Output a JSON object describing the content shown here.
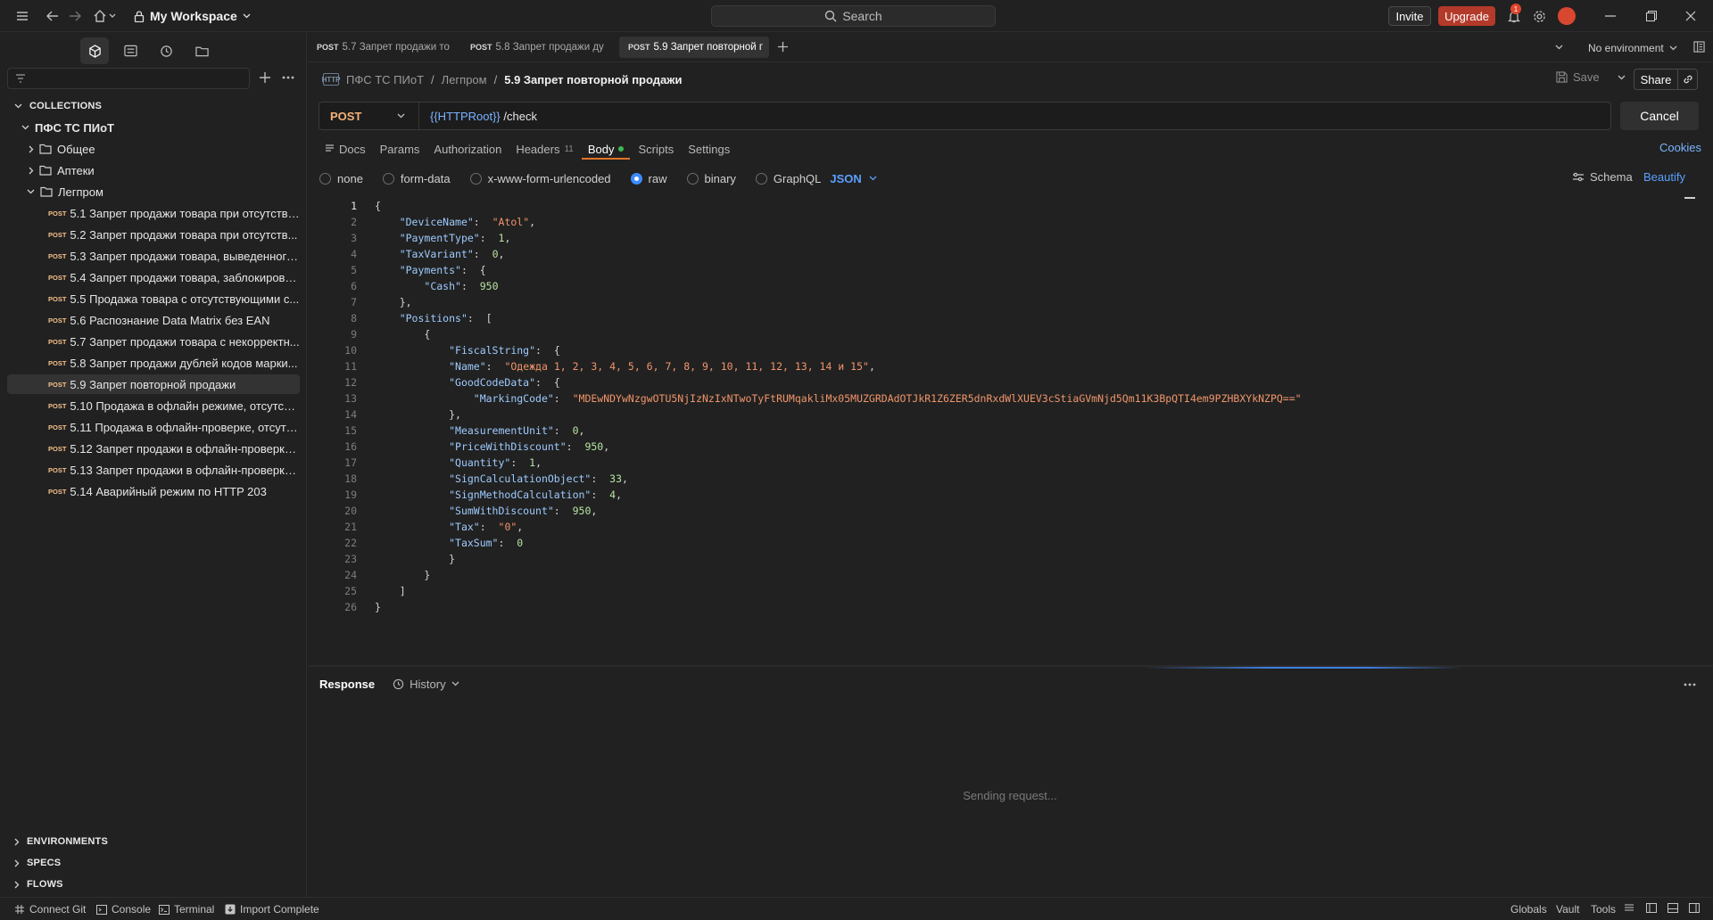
{
  "titlebar": {
    "workspace": "My Workspace",
    "search_placeholder": "Search",
    "invite": "Invite",
    "upgrade": "Upgrade",
    "notification_count": "1"
  },
  "sidebar": {
    "filter_placeholder": "",
    "collections_header": "COLLECTIONS",
    "collection_name": "ПФС ТС ПИоТ",
    "folders": [
      "Общее",
      "Аптеки",
      "Легпром"
    ],
    "method_badge": "POST",
    "requests": [
      "5.1 Запрет продажи товара при отсутстви...",
      "5.2 Запрет продажи товара при отсутств...",
      "5.3 Запрет продажи товара, выведенного...",
      "5.4 Запрет продажи товара, заблокирова...",
      "5.5 Продажа товара с отсутствующими с...",
      "5.6 Распознание Data Matrix без EAN",
      "5.7 Запрет продажи товара с некорректн...",
      "5.8 Запрет продажи дублей кодов марки...",
      "5.9 Запрет повторной продажи",
      "5.10 Продажа в офлайн режиме, отсутств...",
      "5.11 Продажа в офлайн-проверке, отсутст...",
      "5.12 Запрет продажи в офлайн-проверке,...",
      "5.13 Запрет продажи в офлайн-проверке ...",
      "5.14 Аварийный режим по HTTP 203"
    ],
    "environments_header": "ENVIRONMENTS",
    "specs_header": "SPECS",
    "flows_header": "FLOWS"
  },
  "tabs": [
    {
      "method": "POST",
      "label": "5.7 Запрет продажи то"
    },
    {
      "method": "POST",
      "label": "5.8 Запрет продажи ду"
    },
    {
      "method": "POST",
      "label": "5.9 Запрет повторной г"
    }
  ],
  "environment": "No environment",
  "request": {
    "breadcrumb": [
      "ПФС ТС ПИоТ",
      "Легпром",
      "5.9 Запрет повторной продажи"
    ],
    "save_label": "Save",
    "share_label": "Share",
    "method": "POST",
    "url_var": "{{HTTPRoot}}",
    "url_path": " /check",
    "cancel_label": "Cancel",
    "tabs": [
      "Docs",
      "Params",
      "Authorization",
      "Headers",
      "Body",
      "Scripts",
      "Settings"
    ],
    "headers_count": "11",
    "cookies_label": "Cookies",
    "body_types": [
      "none",
      "form-data",
      "x-www-form-urlencoded",
      "raw",
      "binary",
      "GraphQL"
    ],
    "body_language": "JSON",
    "schema_label": "Schema",
    "beautify_label": "Beautify"
  },
  "code_lines": [
    {
      "n": "1",
      "t": "{"
    },
    {
      "n": "2",
      "t": "    \"DeviceName\":  \"Atol\","
    },
    {
      "n": "3",
      "t": "    \"PaymentType\":  1,"
    },
    {
      "n": "4",
      "t": "    \"TaxVariant\":  0,"
    },
    {
      "n": "5",
      "t": "    \"Payments\":  {"
    },
    {
      "n": "6",
      "t": "        \"Cash\":  950"
    },
    {
      "n": "7",
      "t": "    },"
    },
    {
      "n": "8",
      "t": "    \"Positions\":  ["
    },
    {
      "n": "9",
      "t": "        {"
    },
    {
      "n": "10",
      "t": "            \"FiscalString\":  {"
    },
    {
      "n": "11",
      "t": "            \"Name\":  \"Одежда 1, 2, 3, 4, 5, 6, 7, 8, 9, 10, 11, 12, 13, 14 и 15\","
    },
    {
      "n": "12",
      "t": "            \"GoodCodeData\":  {"
    },
    {
      "n": "13",
      "t": "                \"MarkingCode\":  \"MDEwNDYwNzgwOTU5NjIzNzIxNTwoTyFtRUMqakliMx05MUZGRDAdOTJkR1Z6ZER5dnRxdWlXUEV3cStiaGVmNjd5Qm11K3BpQTI4em9PZHBXYkNZPQ==\""
    },
    {
      "n": "14",
      "t": "            },"
    },
    {
      "n": "15",
      "t": "            \"MeasurementUnit\":  0,"
    },
    {
      "n": "16",
      "t": "            \"PriceWithDiscount\":  950,"
    },
    {
      "n": "17",
      "t": "            \"Quantity\":  1,"
    },
    {
      "n": "18",
      "t": "            \"SignCalculationObject\":  33,"
    },
    {
      "n": "19",
      "t": "            \"SignMethodCalculation\":  4,"
    },
    {
      "n": "20",
      "t": "            \"SumWithDiscount\":  950,"
    },
    {
      "n": "21",
      "t": "            \"Tax\":  \"0\","
    },
    {
      "n": "22",
      "t": "            \"TaxSum\":  0"
    },
    {
      "n": "23",
      "t": "            }"
    },
    {
      "n": "24",
      "t": "        }"
    },
    {
      "n": "25",
      "t": "    ]"
    },
    {
      "n": "26",
      "t": "}"
    }
  ],
  "response": {
    "title": "Response",
    "history_label": "History",
    "status_text": "Sending request..."
  },
  "statusbar": {
    "connect_git": "Connect Git",
    "console": "Console",
    "terminal": "Terminal",
    "import_complete": "Import Complete",
    "globals": "Globals",
    "vault": "Vault",
    "tools": "Tools"
  },
  "colors": {
    "accent_blue": "#5aa0ff",
    "method_post": "#f3b27a",
    "upgrade": "#b33a2a",
    "json_key": "#9ecbff",
    "json_string": "#f0956a",
    "json_number": "#b6e3a2"
  }
}
